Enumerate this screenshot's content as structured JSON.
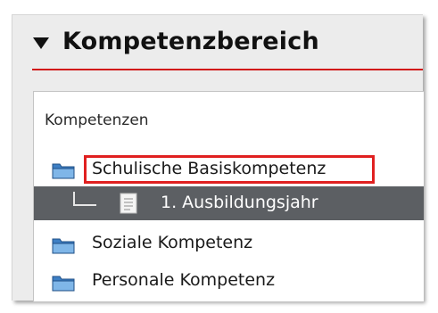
{
  "panel": {
    "title": "Kompetenzbereich",
    "collapse_icon": "triangle-down-icon"
  },
  "tree": {
    "caption": "Kompetenzen",
    "items": [
      {
        "label": "Schulische Basiskompetenz",
        "icon": "folder-icon",
        "highlighted": true
      },
      {
        "label": "1. Ausbildungsjahr",
        "icon": "document-icon",
        "selected": true,
        "child": true
      },
      {
        "label": "Soziale Kompetenz",
        "icon": "folder-icon"
      },
      {
        "label": "Personale Kompetenz",
        "icon": "folder-icon"
      }
    ]
  },
  "colors": {
    "accent_red": "#d11a1a",
    "highlight_border": "#e02020",
    "selected_row": "#5c5f63",
    "folder_blue": "#5b9bd5"
  }
}
